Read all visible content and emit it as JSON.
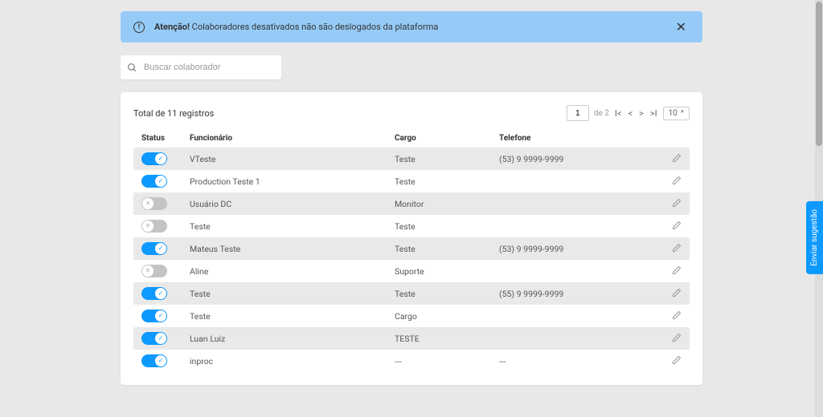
{
  "alert": {
    "bold": "Atenção!",
    "text": " Colaboradores desativados não são deslogados da plataforma"
  },
  "search": {
    "placeholder": "Buscar colaborador"
  },
  "panel": {
    "total_label": "Total de 11 registros"
  },
  "pagination": {
    "current": "1",
    "total_label": "de 2",
    "page_size": "10"
  },
  "columns": {
    "status": "Status",
    "funcionario": "Funcionário",
    "cargo": "Cargo",
    "telefone": "Telefone"
  },
  "rows": [
    {
      "active": true,
      "funcionario": "VTeste",
      "cargo": "Teste",
      "telefone": "(53) 9 9999-9999",
      "shade": true
    },
    {
      "active": true,
      "funcionario": "Production Teste 1",
      "cargo": "Teste",
      "telefone": "",
      "shade": false
    },
    {
      "active": false,
      "funcionario": "Usuário DC",
      "cargo": "Monitor",
      "telefone": "",
      "shade": true
    },
    {
      "active": false,
      "funcionario": "Teste",
      "cargo": "Teste",
      "telefone": "",
      "shade": false
    },
    {
      "active": true,
      "funcionario": "Mateus Teste",
      "cargo": "Teste",
      "telefone": "(53) 9 9999-9999",
      "shade": true
    },
    {
      "active": false,
      "funcionario": "Aline",
      "cargo": "Suporte",
      "telefone": "",
      "shade": false
    },
    {
      "active": true,
      "funcionario": "Teste",
      "cargo": "Teste",
      "telefone": "(55) 9 9999-9999",
      "shade": true
    },
    {
      "active": true,
      "funcionario": "Teste",
      "cargo": "Cargo",
      "telefone": "",
      "shade": false
    },
    {
      "active": true,
      "funcionario": "Luan Luiz",
      "cargo": "TESTE",
      "telefone": "",
      "shade": true
    },
    {
      "active": true,
      "funcionario": "inproc",
      "cargo": "---",
      "telefone": "---",
      "shade": false
    }
  ],
  "feedback_label": "Enviar sugestão"
}
